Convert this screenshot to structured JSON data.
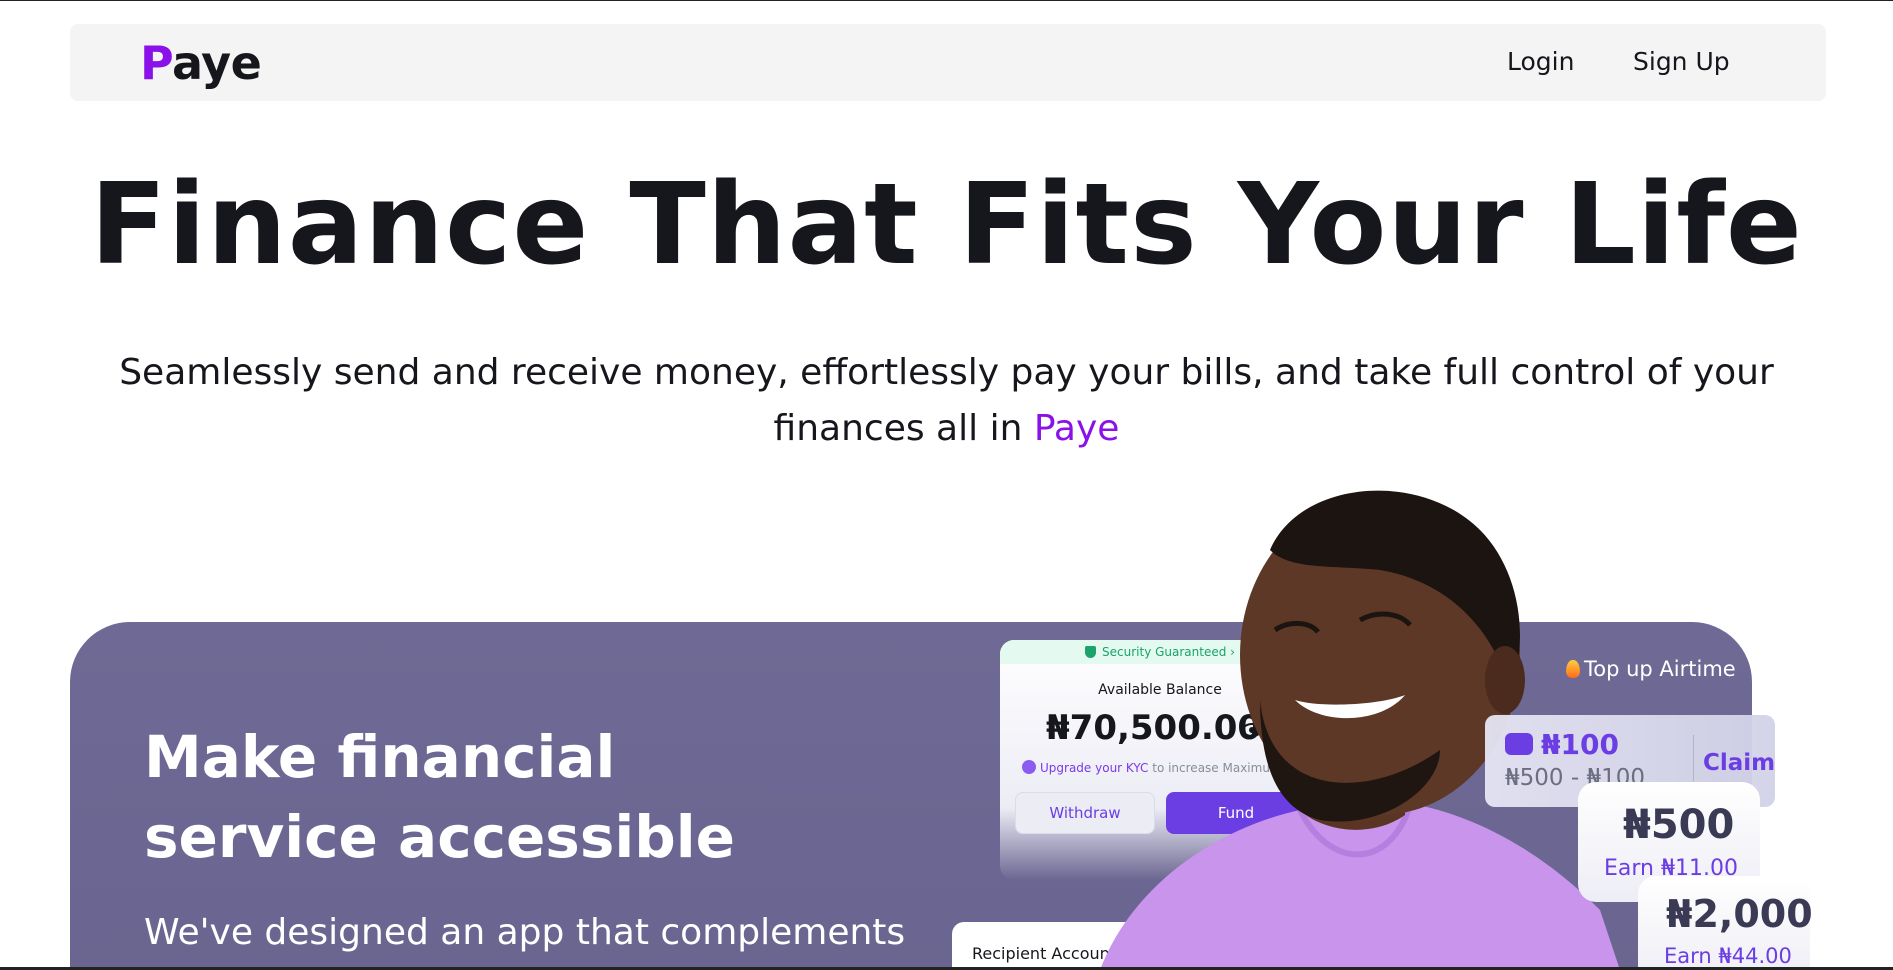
{
  "nav": {
    "logo_initial": "P",
    "logo_rest": "aye",
    "login": "Login",
    "signup": "Sign Up"
  },
  "hero": {
    "title": "Finance That Fits Your Life",
    "subtitle_line1": "Seamlessly send and receive money, effortlessly pay your bills, and take full control of your",
    "subtitle_line2_prefix": "finances all in ",
    "subtitle_brand": "Paye"
  },
  "promo": {
    "title_line1": "Make financial",
    "title_line2": "service accessible",
    "body": "We've designed an app that complements"
  },
  "mockup": {
    "security": "Security Guaranteed  ›",
    "balance_label": "Available Balance",
    "balance_amount": "₦70,500.00",
    "kyc_link": "Upgrade your KYC",
    "kyc_rest": " to increase Maximum Balance",
    "withdraw": "Withdraw",
    "fund": "Fund",
    "recipient_label": "Recipient Account",
    "topup_label": "Top up Airtime",
    "airtime_amount": "₦100",
    "airtime_range": "₦500 - ₦100",
    "claim": "Claim",
    "card_500_amount": "₦500",
    "card_500_earn": "Earn ₦11.00",
    "card_2000_amount": "₦2,000",
    "card_2000_earn": "Earn ₦44.00"
  },
  "colors": {
    "brand_purple": "#8a12e8",
    "promo_bg": "#6f6a95",
    "button_purple": "#6b3ee3",
    "navbar_bg": "#f4f4f4"
  },
  "icons": {
    "shield": "shield-icon",
    "eye": "eye-icon",
    "bolt": "bolt-icon",
    "fire": "fire-icon",
    "airtime": "ticket-icon"
  }
}
